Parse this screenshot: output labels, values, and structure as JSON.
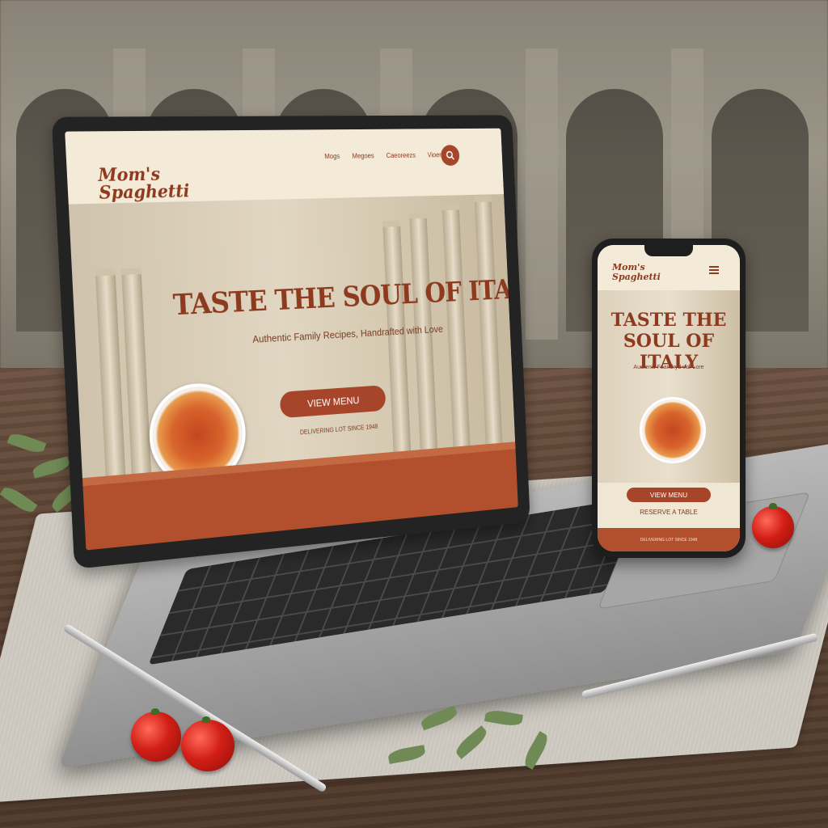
{
  "desktop_site": {
    "logo": "Mom's Spaghetti",
    "nav": [
      "Mogs",
      "Megoes",
      "Caeoreezs",
      "Vioer"
    ],
    "hero_title": "TASTE THE SOUL OF ITALY",
    "hero_subtitle": "Authentic Family Recipes, Handrafted with Love",
    "cta_button": "VIEW MENU",
    "tagline": "DELIVERING LOT SINCE 1948"
  },
  "mobile_site": {
    "logo": "Mom's Spaghetti",
    "hero_title": "TASTE THE SOUL OF ITALY",
    "hero_subtitle": "Audtenis Feandryd vidl Lore",
    "cta_button": "VIEW MENU",
    "secondary_link": "RESERVE A TABLE",
    "footer_text": "DELIVERING LOT SINCE 1948"
  },
  "icons": {
    "search": "search-icon",
    "menu": "hamburger-menu-icon"
  },
  "colors": {
    "brand": "#8e3a1f",
    "accent": "#a7452a",
    "background": "#efe6d3",
    "footer": "#b24f2c"
  }
}
